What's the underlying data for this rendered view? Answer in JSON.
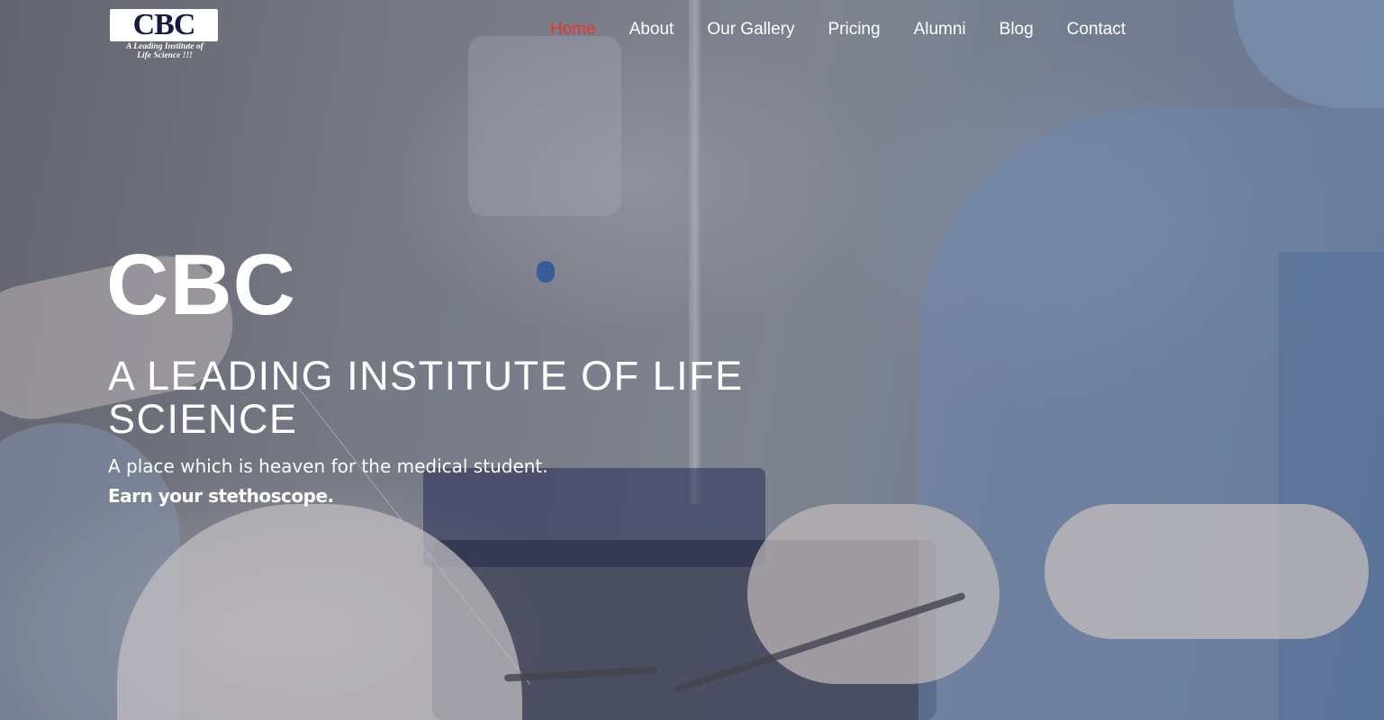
{
  "header": {
    "logo": {
      "text": "CBC",
      "tagline_line1": "A Leading Institute of",
      "tagline_line2": "Life Science !!!"
    },
    "nav": [
      {
        "label": "Home",
        "active": true
      },
      {
        "label": "About",
        "active": false
      },
      {
        "label": "Our Gallery",
        "active": false
      },
      {
        "label": "Pricing",
        "active": false
      },
      {
        "label": "Alumni",
        "active": false
      },
      {
        "label": "Blog",
        "active": false
      },
      {
        "label": "Contact",
        "active": false
      }
    ]
  },
  "hero": {
    "title": "CBC",
    "subtitle": "A LEADING INSTITUTE OF LIFE SCIENCE",
    "text": "A place which is heaven for the medical student.",
    "cta": "Earn your stethoscope."
  },
  "colors": {
    "nav_active": "#e8342c",
    "text": "#ffffff",
    "logo_ink": "#141b3f"
  },
  "background": {
    "description_icon": "surgical-operation-photo"
  }
}
